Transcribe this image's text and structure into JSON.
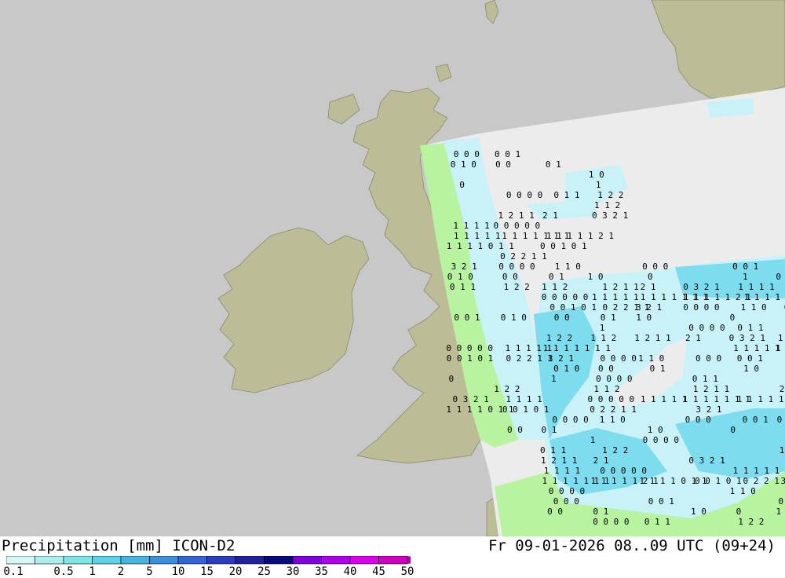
{
  "title": {
    "left": "Precipitation [mm] ICON-D2",
    "right": "Fr 09-01-2026 08..09 UTC (09+24)"
  },
  "legend": {
    "labels": [
      "0.1",
      "0.5",
      "1",
      "2",
      "5",
      "10",
      "15",
      "20",
      "25",
      "30",
      "35",
      "40",
      "45",
      "50"
    ],
    "colors": [
      "#d4f7f7",
      "#a8efef",
      "#7de7e7",
      "#5ad2e8",
      "#45b4e0",
      "#3c8ee0",
      "#3464d8",
      "#2a3cc0",
      "#2020a0",
      "#0a0a80",
      "#8000e0",
      "#b000f0",
      "#e000f0",
      "#d000c0",
      "#b000a0"
    ]
  },
  "map_colors": {
    "sea": "#c8c8c8",
    "land": "#bcbc96",
    "model_domain": "#ececec",
    "light_precip": "#b8f3a0",
    "precip_01": "#c8f2f7",
    "precip_05": "#a0e8f2",
    "precip_1": "#7ddcee",
    "precip_2": "#5fd0e8"
  },
  "grid_values": [
    "0 0 0",
    "0 0 1",
    "0 1 0",
    "0 0",
    "0 1",
    "1 0",
    "0",
    "1",
    "0 0 0 0",
    "0 1 1",
    "1 2 2",
    "1 1 2",
    "1 2 1 1",
    "2 1",
    "0 3 2 1",
    "1 1 1 1",
    "0 0 0 0 0",
    "1 1 1 1 1",
    "1 1 1 1 1 1 1",
    "1 1 1 1 1 2 1",
    "1 1 1 1 0 1 1",
    "0 0 1 0 1",
    "0 2 2 1 1",
    "3 2 1",
    "0 0 0 0",
    "1 1 0"
  ]
}
